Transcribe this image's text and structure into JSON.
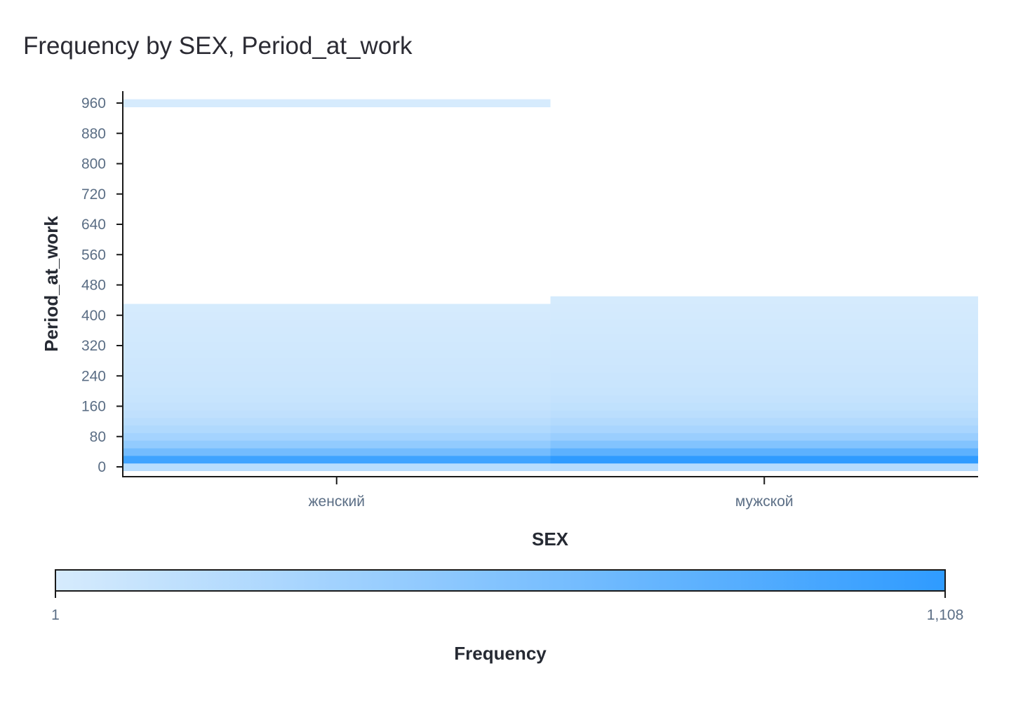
{
  "chart_data": {
    "type": "heatmap",
    "title": "Frequency by SEX, Period_at_work",
    "xlabel": "SEX",
    "ylabel": "Period_at_work",
    "categories": [
      "женский",
      "мужской"
    ],
    "y_ticks": [
      0,
      80,
      160,
      240,
      320,
      400,
      480,
      560,
      640,
      720,
      800,
      880,
      960
    ],
    "ylim": [
      -10,
      1010
    ],
    "bin_width": 20,
    "colorbar": {
      "label": "Frequency",
      "min": 1,
      "max": 1108,
      "min_label": "1",
      "max_label": "1,108",
      "color_low": "#d6ebfd",
      "color_high": "#2f9bff"
    },
    "series": [
      {
        "name": "женский",
        "bins": [
          {
            "y0": -10,
            "y1": 10,
            "value": 200
          },
          {
            "y0": 10,
            "y1": 30,
            "value": 1000
          },
          {
            "y0": 30,
            "y1": 50,
            "value": 650
          },
          {
            "y0": 50,
            "y1": 70,
            "value": 450
          },
          {
            "y0": 70,
            "y1": 90,
            "value": 330
          },
          {
            "y0": 90,
            "y1": 110,
            "value": 250
          },
          {
            "y0": 110,
            "y1": 130,
            "value": 190
          },
          {
            "y0": 130,
            "y1": 150,
            "value": 150
          },
          {
            "y0": 150,
            "y1": 170,
            "value": 120
          },
          {
            "y0": 170,
            "y1": 190,
            "value": 100
          },
          {
            "y0": 190,
            "y1": 210,
            "value": 85
          },
          {
            "y0": 210,
            "y1": 230,
            "value": 75
          },
          {
            "y0": 230,
            "y1": 250,
            "value": 65
          },
          {
            "y0": 250,
            "y1": 270,
            "value": 58
          },
          {
            "y0": 270,
            "y1": 290,
            "value": 52
          },
          {
            "y0": 290,
            "y1": 310,
            "value": 46
          },
          {
            "y0": 310,
            "y1": 330,
            "value": 40
          },
          {
            "y0": 330,
            "y1": 350,
            "value": 34
          },
          {
            "y0": 350,
            "y1": 370,
            "value": 28
          },
          {
            "y0": 370,
            "y1": 390,
            "value": 22
          },
          {
            "y0": 390,
            "y1": 410,
            "value": 14
          },
          {
            "y0": 410,
            "y1": 430,
            "value": 6
          },
          {
            "y0": 950,
            "y1": 970,
            "value": 1
          }
        ]
      },
      {
        "name": "мужской",
        "bins": [
          {
            "y0": -10,
            "y1": 10,
            "value": 220
          },
          {
            "y0": 10,
            "y1": 30,
            "value": 1108
          },
          {
            "y0": 30,
            "y1": 50,
            "value": 800
          },
          {
            "y0": 50,
            "y1": 70,
            "value": 560
          },
          {
            "y0": 70,
            "y1": 90,
            "value": 400
          },
          {
            "y0": 90,
            "y1": 110,
            "value": 300
          },
          {
            "y0": 110,
            "y1": 130,
            "value": 230
          },
          {
            "y0": 130,
            "y1": 150,
            "value": 180
          },
          {
            "y0": 150,
            "y1": 170,
            "value": 145
          },
          {
            "y0": 170,
            "y1": 190,
            "value": 120
          },
          {
            "y0": 190,
            "y1": 210,
            "value": 100
          },
          {
            "y0": 210,
            "y1": 230,
            "value": 88
          },
          {
            "y0": 230,
            "y1": 250,
            "value": 78
          },
          {
            "y0": 250,
            "y1": 270,
            "value": 70
          },
          {
            "y0": 270,
            "y1": 290,
            "value": 62
          },
          {
            "y0": 290,
            "y1": 310,
            "value": 55
          },
          {
            "y0": 310,
            "y1": 330,
            "value": 48
          },
          {
            "y0": 330,
            "y1": 350,
            "value": 42
          },
          {
            "y0": 350,
            "y1": 370,
            "value": 35
          },
          {
            "y0": 370,
            "y1": 390,
            "value": 28
          },
          {
            "y0": 390,
            "y1": 410,
            "value": 20
          },
          {
            "y0": 410,
            "y1": 430,
            "value": 12
          },
          {
            "y0": 430,
            "y1": 450,
            "value": 5
          }
        ]
      }
    ]
  }
}
